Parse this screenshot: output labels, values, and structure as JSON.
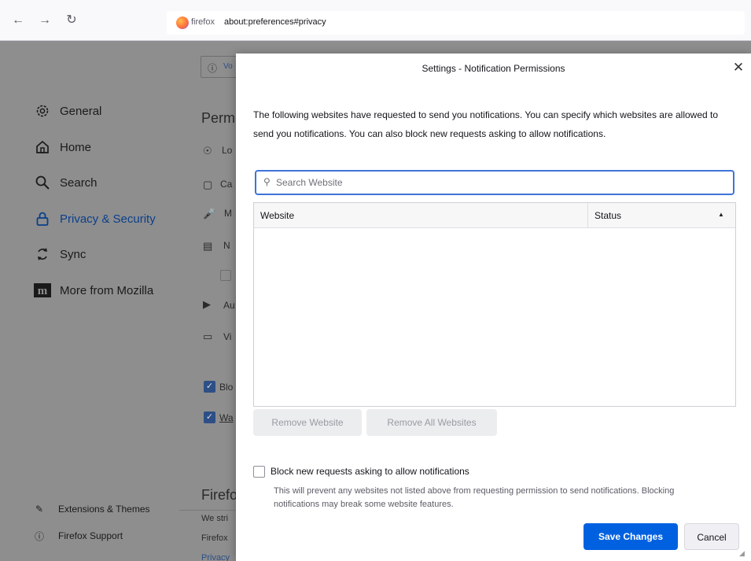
{
  "toolbar": {
    "back_icon": "arrow-left-icon",
    "forward_icon": "arrow-right-icon",
    "reload_icon": "reload-icon",
    "identity_label": "firefox",
    "url": "about:preferences#privacy"
  },
  "sidebar": {
    "items": [
      {
        "label": "General",
        "icon": "gear-icon"
      },
      {
        "label": "Home",
        "icon": "home-icon"
      },
      {
        "label": "Search",
        "icon": "search-icon"
      },
      {
        "label": "Privacy & Security",
        "icon": "lock-icon",
        "active": true
      },
      {
        "label": "Sync",
        "icon": "sync-icon"
      },
      {
        "label": "More from Mozilla",
        "icon": "mozilla-icon"
      }
    ],
    "footer": [
      {
        "label": "Extensions & Themes",
        "icon": "puzzle-icon"
      },
      {
        "label": "Firefox Support",
        "icon": "help-icon"
      }
    ]
  },
  "background_page": {
    "banner_fragment": "Vo",
    "section_fragment": "Perm",
    "rows": [
      "Lo",
      "Ca",
      "M",
      "N",
      "Au",
      "Vi"
    ],
    "checks": [
      "Blo",
      "Wa"
    ],
    "firefox_fragment": "Firefo",
    "lines": [
      "We stri",
      "Firefox",
      "Privacy"
    ]
  },
  "dialog": {
    "title": "Settings - Notification Permissions",
    "intro": "The following websites have requested to send you notifications. You can specify which websites are allowed to send you notifications. You can also block new requests asking to allow notifications.",
    "search_placeholder": "Search Website",
    "columns": {
      "website": "Website",
      "status": "Status"
    },
    "rows": [],
    "remove_website": "Remove Website",
    "remove_all": "Remove All Websites",
    "block_label": "Block new requests asking to allow notifications",
    "block_checked": false,
    "block_note": "This will prevent any websites not listed above from requesting permission to send notifications. Blocking notifications may break some website features.",
    "save_label": "Save Changes",
    "cancel_label": "Cancel"
  },
  "colors": {
    "accent": "#0061e0",
    "focus_ring": "#3f74d8",
    "active_nav": "#0b3f8a",
    "overlay_gray": "#8e8e8e"
  }
}
